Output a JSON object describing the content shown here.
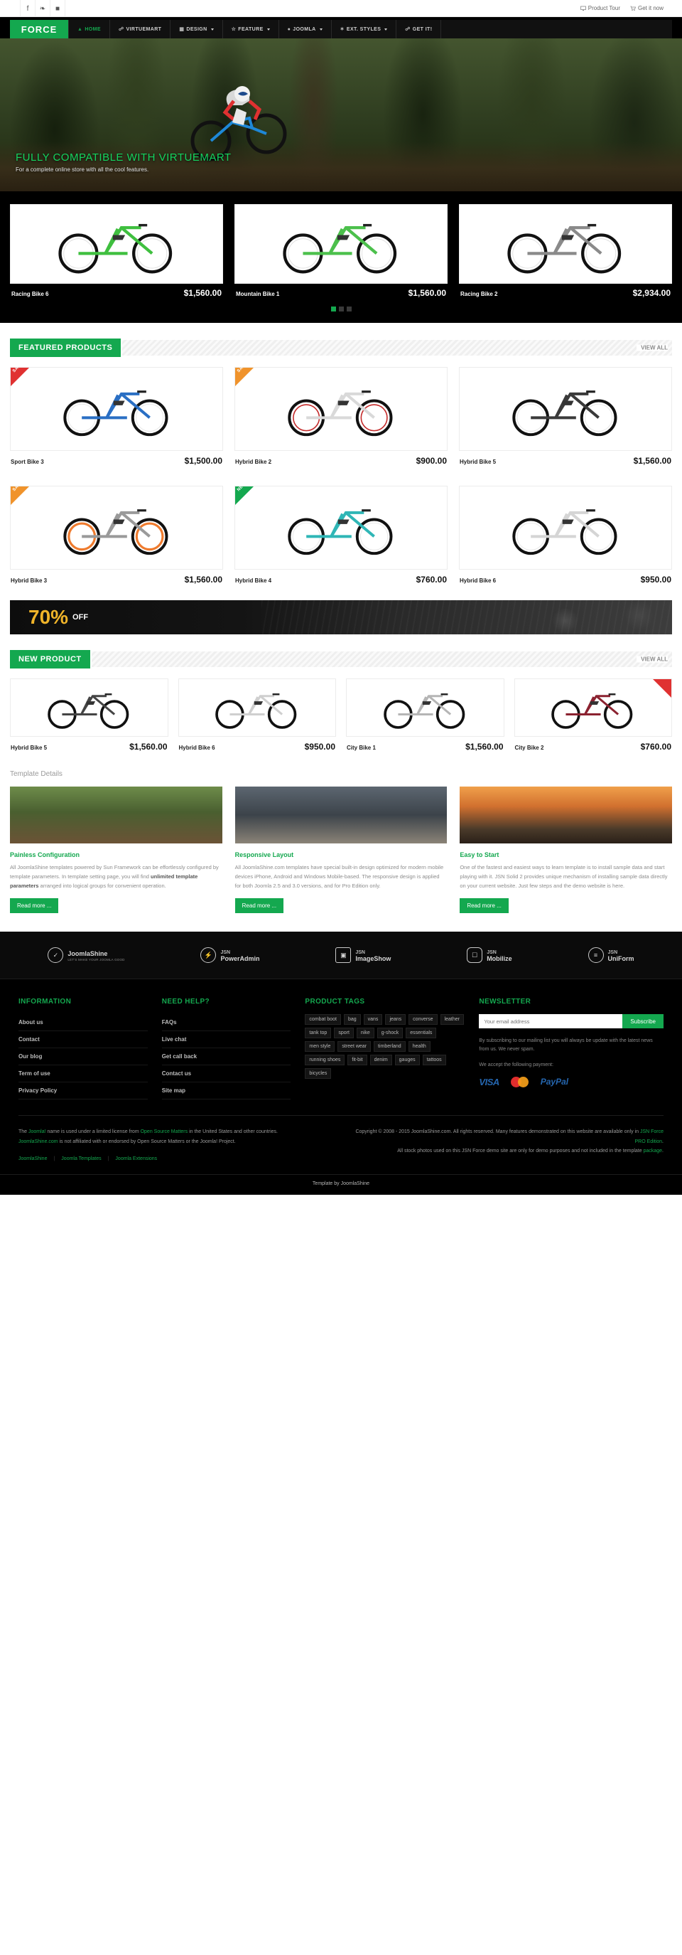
{
  "topbar": {
    "social": [
      {
        "name": "facebook-icon",
        "glyph": "f"
      },
      {
        "name": "twitter-icon",
        "glyph": "❧"
      },
      {
        "name": "youtube-icon",
        "glyph": "■"
      }
    ],
    "product_tour": "Product Tour",
    "get_it_now": "Get it now"
  },
  "nav": {
    "logo": "FORCE",
    "items": [
      {
        "label": "HOME",
        "icon": "home-icon",
        "active": true,
        "caret": false
      },
      {
        "label": "VIRTUEMART",
        "icon": "cart-icon",
        "active": false,
        "caret": false
      },
      {
        "label": "DESIGN",
        "icon": "image-icon",
        "active": false,
        "caret": true
      },
      {
        "label": "FEATURE",
        "icon": "star-icon",
        "active": false,
        "caret": true
      },
      {
        "label": "JOOMLA",
        "icon": "user-icon",
        "active": false,
        "caret": true
      },
      {
        "label": "EXT. STYLES",
        "icon": "gear-icon",
        "active": false,
        "caret": true
      },
      {
        "label": "GET IT!",
        "icon": "basket-icon",
        "active": false,
        "caret": false
      }
    ]
  },
  "hero": {
    "title": "FULLY COMPATIBLE WITH VIRTUEMART",
    "subtitle": "For a complete online store with all the cool features."
  },
  "slider": {
    "products": [
      {
        "name": "Racing Bike 6",
        "price": "$1,560.00"
      },
      {
        "name": "Mountain Bike 1",
        "price": "$1,560.00"
      },
      {
        "name": "Racing Bike 2",
        "price": "$2,934.00"
      }
    ],
    "dots": [
      true,
      false,
      false
    ]
  },
  "featured": {
    "title": "FEATURED PRODUCTS",
    "view_all": "VIEW ALL",
    "products": [
      {
        "name": "Sport Bike 3",
        "price": "$1,500.00",
        "ribbon": "SALE",
        "ribbon_color": "red"
      },
      {
        "name": "Hybrid Bike 2",
        "price": "$900.00",
        "ribbon": "SALE",
        "ribbon_color": "orange"
      },
      {
        "name": "Hybrid Bike 5",
        "price": "$1,560.00",
        "ribbon": "",
        "ribbon_color": ""
      },
      {
        "name": "Hybrid Bike 3",
        "price": "$1,560.00",
        "ribbon": "SALE",
        "ribbon_color": "orange"
      },
      {
        "name": "Hybrid Bike 4",
        "price": "$760.00",
        "ribbon": "NEW",
        "ribbon_color": "green"
      },
      {
        "name": "Hybrid Bike 6",
        "price": "$950.00",
        "ribbon": "",
        "ribbon_color": ""
      }
    ]
  },
  "promo": {
    "number": "70%",
    "off": "OFF"
  },
  "new_product": {
    "title": "NEW PRODUCT",
    "view_all": "VIEW ALL",
    "products": [
      {
        "name": "Hybrid Bike 5",
        "price": "$1,560.00",
        "ribbon_right": false
      },
      {
        "name": "Hybrid Bike 6",
        "price": "$950.00",
        "ribbon_right": false
      },
      {
        "name": "City Bike 1",
        "price": "$1,560.00",
        "ribbon_right": false
      },
      {
        "name": "City Bike 2",
        "price": "$760.00",
        "ribbon_right": true
      }
    ]
  },
  "template_details": {
    "heading": "Template Details",
    "cards": [
      {
        "title": "Painless Configuration",
        "text_1": "All JoomlaShine templates powered by Sun Framework can be effortlessly configured by template parameters. In template setting page, you will find ",
        "bold": "unlimited template parameters",
        "text_2": " arranged into logical groups for convenient operation.",
        "button": "Read more ..."
      },
      {
        "title": "Responsive Layout",
        "text_1": "All JoomlaShine.com templates have special built-in design optimized for modern mobile devices iPhone, Android and Windows Mobile-based. The responsive design is applied for both Joomla 2.5 and 3.0 versions, and for Pro Edition only.",
        "bold": "",
        "text_2": "",
        "button": "Read more ..."
      },
      {
        "title": "Easy to Start",
        "text_1": "One of the fastest and easiest ways to learn template is to install sample data and start playing with it. JSN Solid 2 provides unique mechanism of installing sample data directly on your current website. Just few steps and the demo website is here.",
        "bold": "",
        "text_2": "",
        "button": "Read more ..."
      }
    ]
  },
  "brands": [
    {
      "name": "JoomlaShine",
      "tagline": "LET'S MAKE YOUR JOOMLA GOOD",
      "icon": "joomlashine-icon",
      "shape": "circle"
    },
    {
      "name": "JSN",
      "sub": "PowerAdmin",
      "icon": "poweradmin-icon",
      "shape": "circle"
    },
    {
      "name": "JSN",
      "sub": "ImageShow",
      "icon": "imageshow-icon",
      "shape": "sq"
    },
    {
      "name": "JSN",
      "sub": "Mobilize",
      "icon": "mobilize-icon",
      "shape": "rr"
    },
    {
      "name": "JSN",
      "sub": "UniForm",
      "icon": "uniform-icon",
      "shape": "circle"
    }
  ],
  "footer": {
    "information": {
      "heading": "INFORMATION",
      "links": [
        "About us",
        "Contact",
        "Our blog",
        "Term of use",
        "Privacy Policy"
      ]
    },
    "need_help": {
      "heading": "NEED HELP?",
      "links": [
        "FAQs",
        "Live chat",
        "Get call back",
        "Contact us",
        "Site map"
      ]
    },
    "product_tags": {
      "heading": "PRODUCT TAGS",
      "tags": [
        "combat boot",
        "bag",
        "vans",
        "jeans",
        "converse",
        "leather",
        "tank top",
        "sport",
        "nike",
        "g-shock",
        "essentials",
        "men style",
        "street wear",
        "timberland",
        "health",
        "running shoes",
        "fit-bit",
        "denim",
        "gauges",
        "tattoos",
        "bicycles"
      ]
    },
    "newsletter": {
      "heading": "NEWSLETTER",
      "placeholder": "Your email address",
      "button": "Subscribe",
      "note": "By subscribing to our mailing list you will always be update with the latest news from us. We never spam.",
      "payment_label": "We accept the following payment:",
      "payments": [
        "VISA",
        "MasterCard",
        "PayPal"
      ]
    },
    "legal_left_1_a": "The ",
    "legal_left_1_link": "Joomla!",
    "legal_left_1_b": " name is used under a limited license from ",
    "legal_left_1_link2": "Open Source Matters",
    "legal_left_1_c": " in the United States and other countries.",
    "legal_left_2_link": "JoomlaShine.com",
    "legal_left_2": " is not affiliated with or endorsed by Open Source Matters or the Joomla! Project.",
    "mini_links": [
      "JoomlaShine",
      "Joomla Templates",
      "Joomla Extensions"
    ],
    "legal_right_1": "Copyright © 2008 - 2015 JoomlaShine.com. All rights reserved. Many features demonstrated on this website are available only in ",
    "legal_right_1_link": "JSN Force PRO Edition",
    "legal_right_1_end": ".",
    "legal_right_2": "All stock photos used on this JSN Force demo site are only for demo purposes and not included in the template ",
    "legal_right_2_link": "package",
    "legal_right_2_end": ".",
    "credit": "Template by JoomlaShine"
  },
  "colors": {
    "accent": "#14a84f",
    "dark": "#000000",
    "sale_red": "#e03131",
    "sale_orange": "#f0932b"
  }
}
